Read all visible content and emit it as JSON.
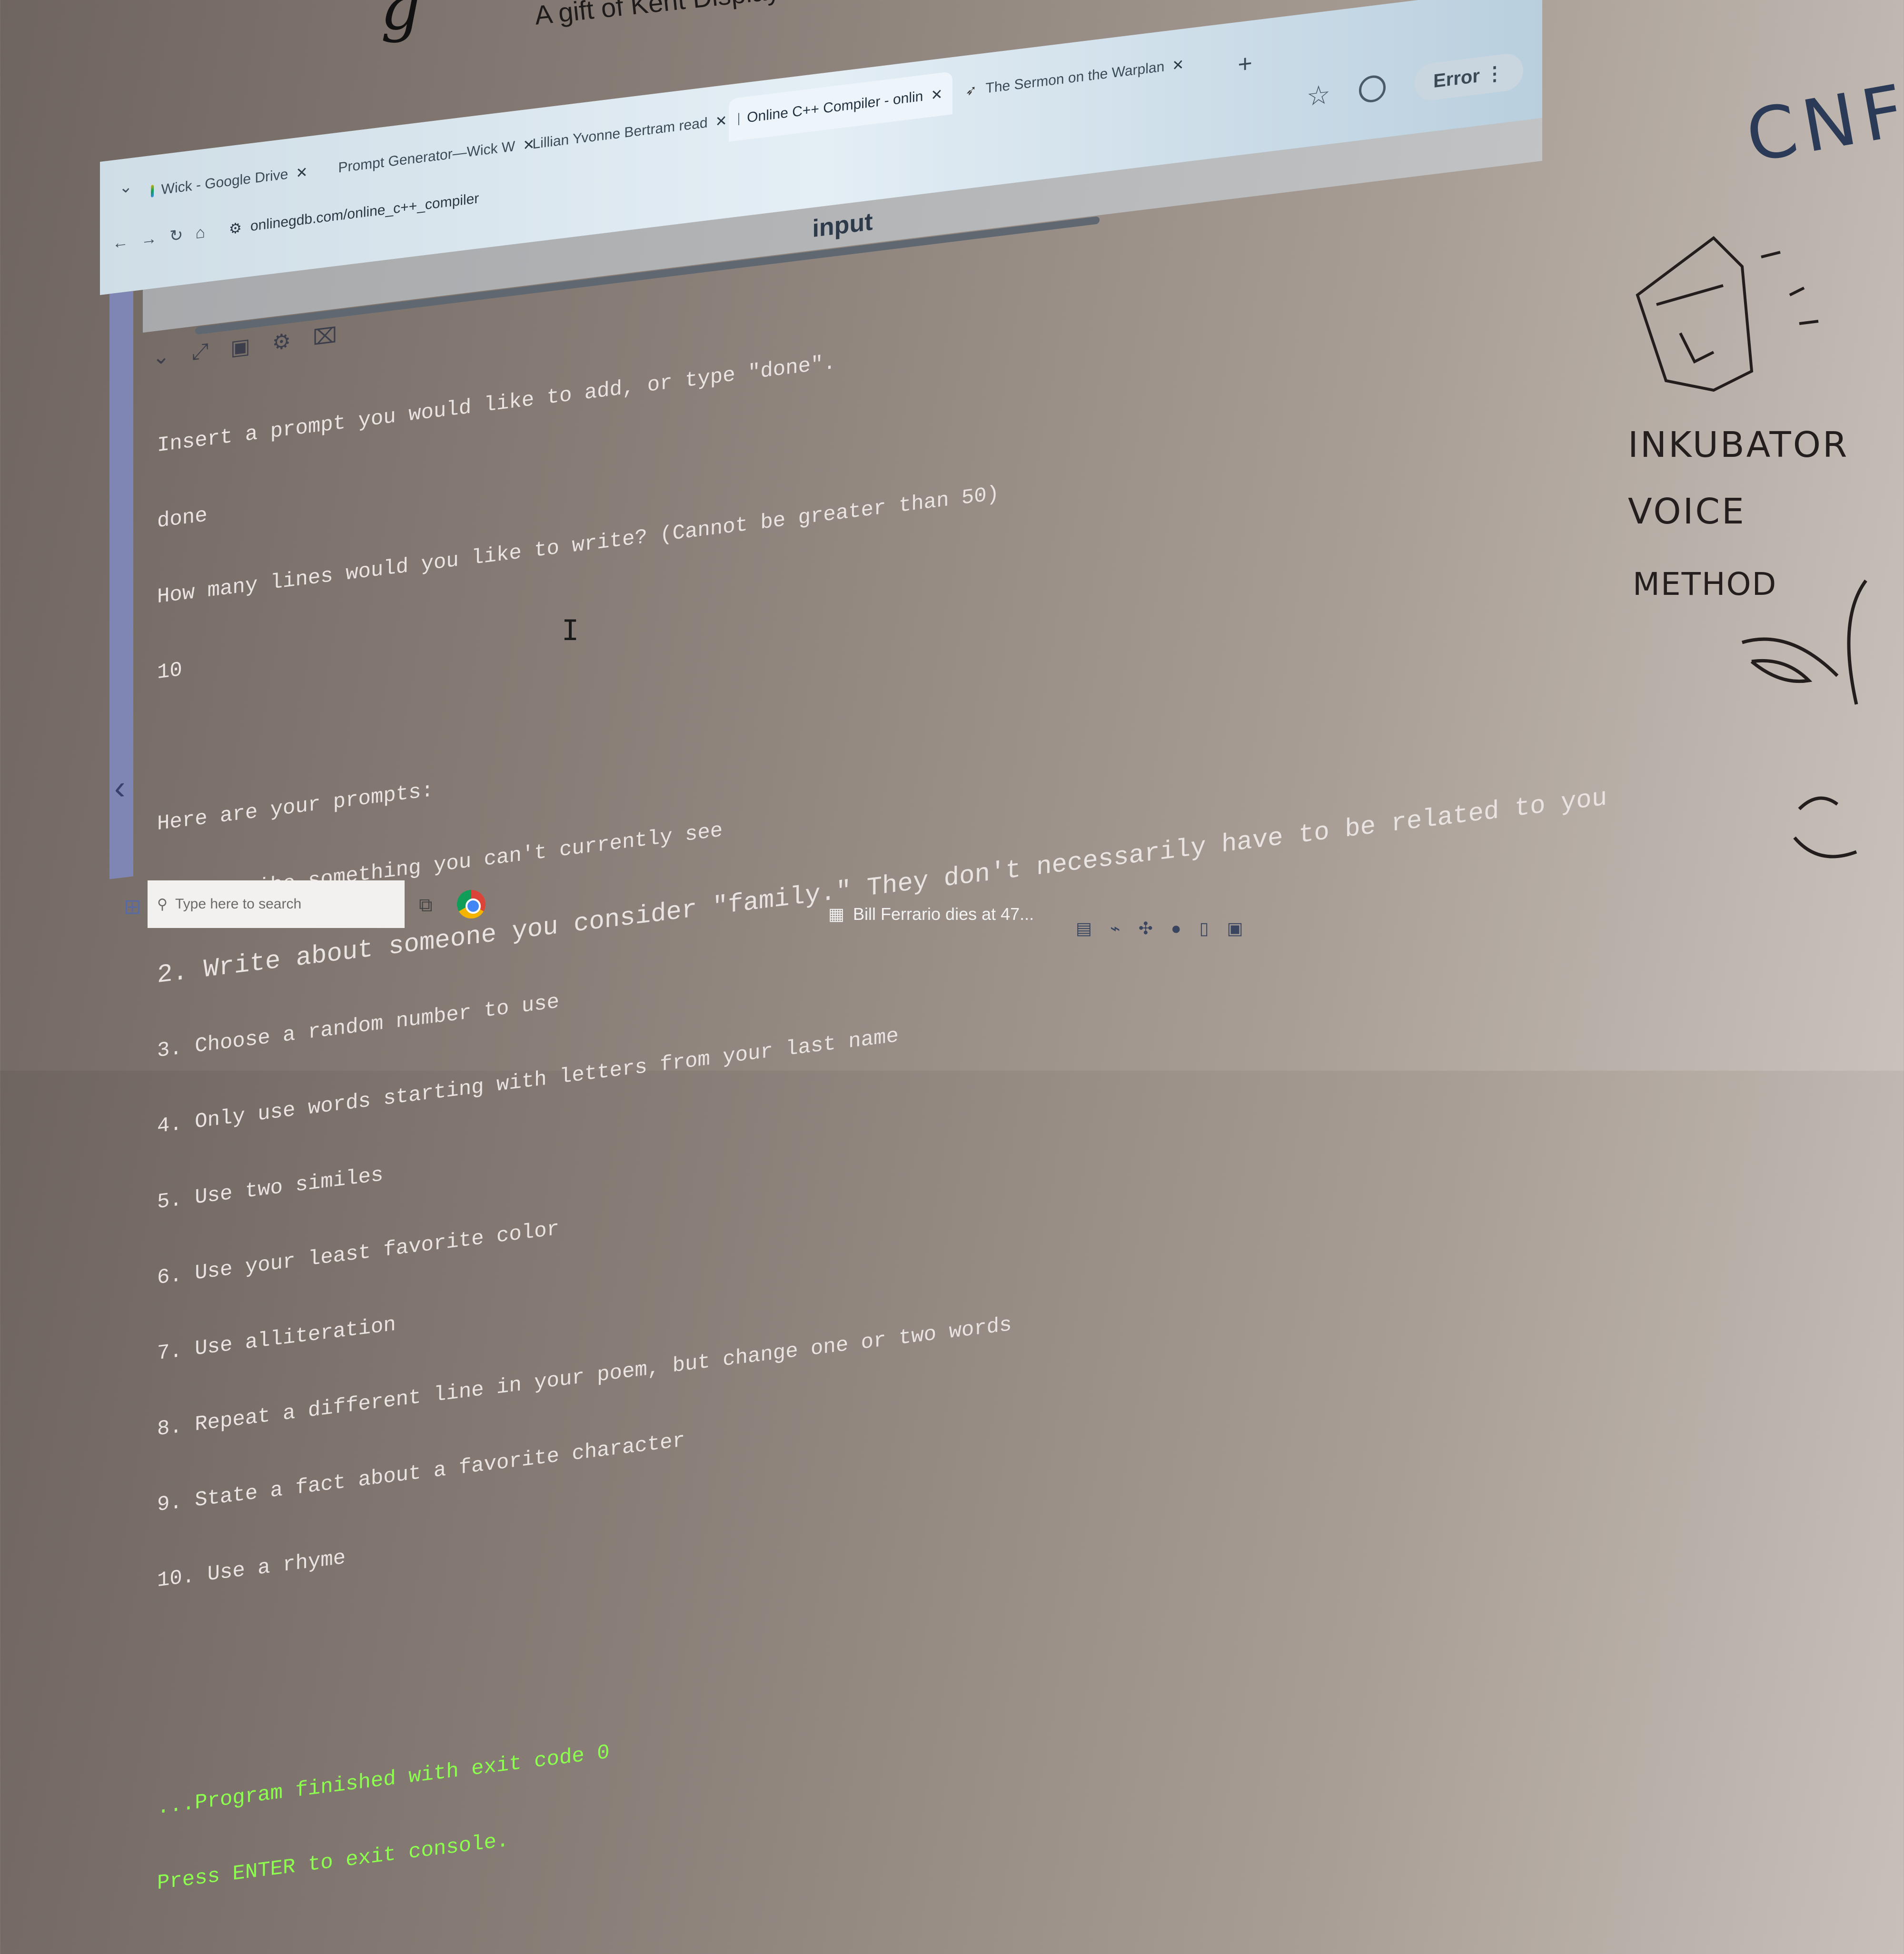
{
  "wall": {
    "header_text": "A gift of Kent Displays",
    "whiteboard_words": [
      "CNF",
      "INKUBATOR",
      "VOICE",
      "METHOD"
    ]
  },
  "browser": {
    "tabs": [
      {
        "label": "Wick - Google Drive",
        "favicon": "drive-icon"
      },
      {
        "label": "Prompt Generator—Wick W",
        "favicon": "docs-icon"
      },
      {
        "label": "Lillian Yvonne Bertram read",
        "favicon": "youtube-icon"
      },
      {
        "label": "Online C++ Compiler - onlin",
        "favicon": "onlinegdb-icon"
      },
      {
        "label": "The Sermon on the Warplan",
        "favicon": "arrow-icon"
      }
    ],
    "new_tab": "+",
    "url": "onlinegdb.com/online_c++_compiler",
    "error_chip": "Error"
  },
  "ide": {
    "panel_title": "input",
    "console_lines": [
      "Insert a prompt you would like to add, or type \"done\".",
      "done",
      "How many lines would you like to write? (Cannot be greater than 50)",
      "10",
      "",
      "Here are your prompts:",
      "1. Describe something you can't currently see",
      "2. Write about someone you consider \"family.\" They don't necessarily have to be related to you",
      "3. Choose a random number to use",
      "4. Only use words starting with letters from your last name",
      "5. Use two similes",
      "6. Use your least favorite color",
      "7. Use alliteration",
      "8. Repeat a different line in your poem, but change one or two words",
      "9. State a fact about a favorite character",
      "10. Use a rhyme",
      "",
      "",
      "...Program finished with exit code 0",
      "Press ENTER to exit console."
    ]
  },
  "taskbar": {
    "search_placeholder": "Type here to search",
    "news": "Bill Ferrario dies at 47..."
  }
}
